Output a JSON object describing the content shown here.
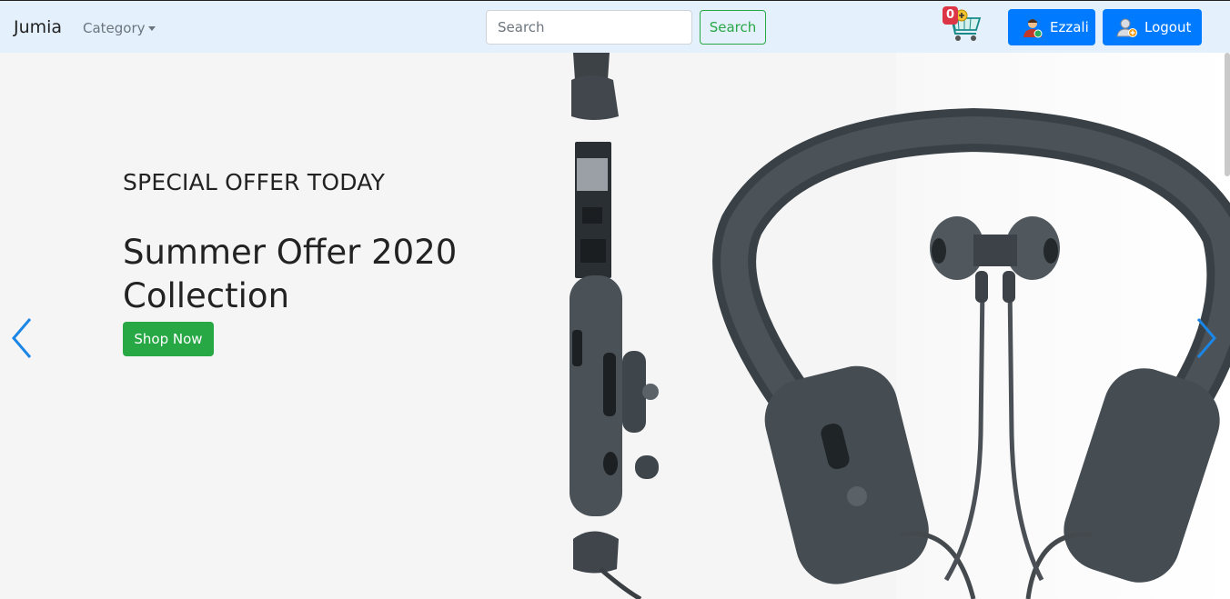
{
  "navbar": {
    "brand": "Jumia",
    "category_label": "Category",
    "search_placeholder": "Search",
    "search_button": "Search",
    "cart_count": "0",
    "user_label": "Ezzali",
    "logout_label": "Logout"
  },
  "hero": {
    "subtitle": "SPECIAL OFFER TODAY",
    "title": "Summer Offer 2020 Collection",
    "button": "Shop Now"
  },
  "icons": {
    "cart": "shopping-cart-icon",
    "user": "user-avatar-icon",
    "logout": "logout-user-icon",
    "prev": "chevron-left-icon",
    "next": "chevron-right-icon"
  },
  "colors": {
    "navbar_bg": "#e4f1fc",
    "primary": "#007bff",
    "success": "#28a745",
    "danger": "#dc3545"
  }
}
